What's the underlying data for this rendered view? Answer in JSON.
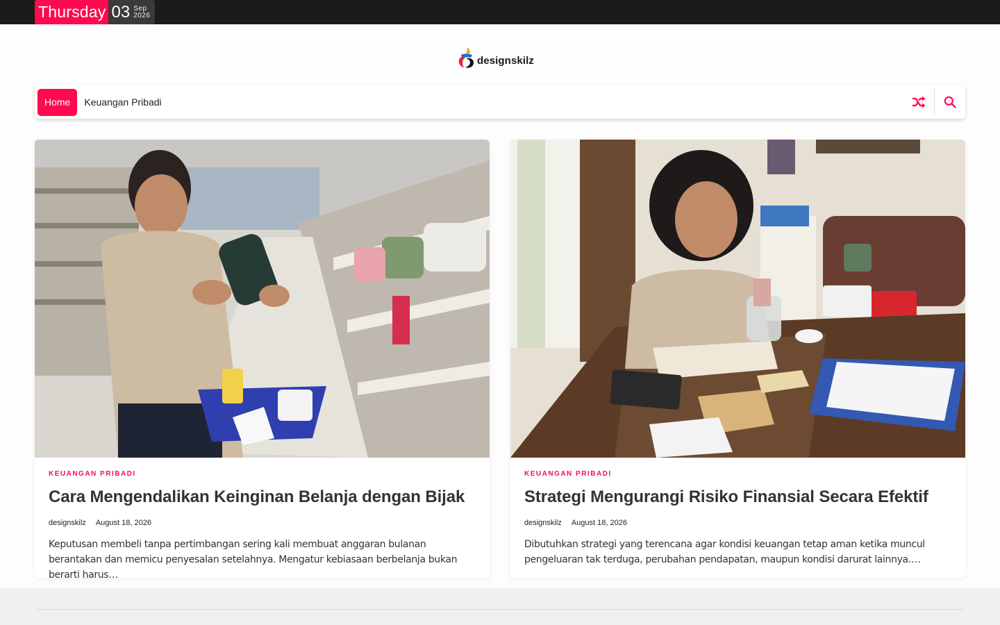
{
  "date": {
    "day_name": "Thursday",
    "day_number": "03",
    "month": "Sep",
    "year": "2026"
  },
  "site": {
    "logo_text": "designskilz"
  },
  "nav": {
    "items": [
      {
        "label": "Home",
        "active": true
      },
      {
        "label": "Keuangan Pribadi",
        "active": false
      }
    ],
    "icons": [
      "shuffle-icon",
      "search-icon"
    ]
  },
  "posts": [
    {
      "category": "KEUANGAN PRIBADI",
      "title": "Cara Mengendalikan Keinginan Belanja dengan Bijak",
      "author": "designskilz",
      "date": "August 18, 2026",
      "excerpt": "Keputusan membeli tanpa pertimbangan sering kali membuat anggaran bulanan berantakan dan memicu penyesalan setelahnya. Mengatur kebiasaan berbelanja bukan berarti harus…",
      "image": "man-shopping-in-appliance-store-photo"
    },
    {
      "category": "KEUANGAN PRIBADI",
      "title": "Strategi Mengurangi Risiko Finansial Secara Efektif",
      "author": "designskilz",
      "date": "August 18, 2026",
      "excerpt": "Dibutuhkan strategi yang terencana agar kondisi keuangan tetap aman ketika muncul pengeluaran tak terduga, perubahan pendapatan, maupun kondisi darurat lainnya.…",
      "image": "woman-saving-money-at-table-photo"
    }
  ],
  "colors": {
    "accent": "#ff0a50",
    "topbar": "#1b1b1b",
    "footer": "#f0f0f0"
  }
}
